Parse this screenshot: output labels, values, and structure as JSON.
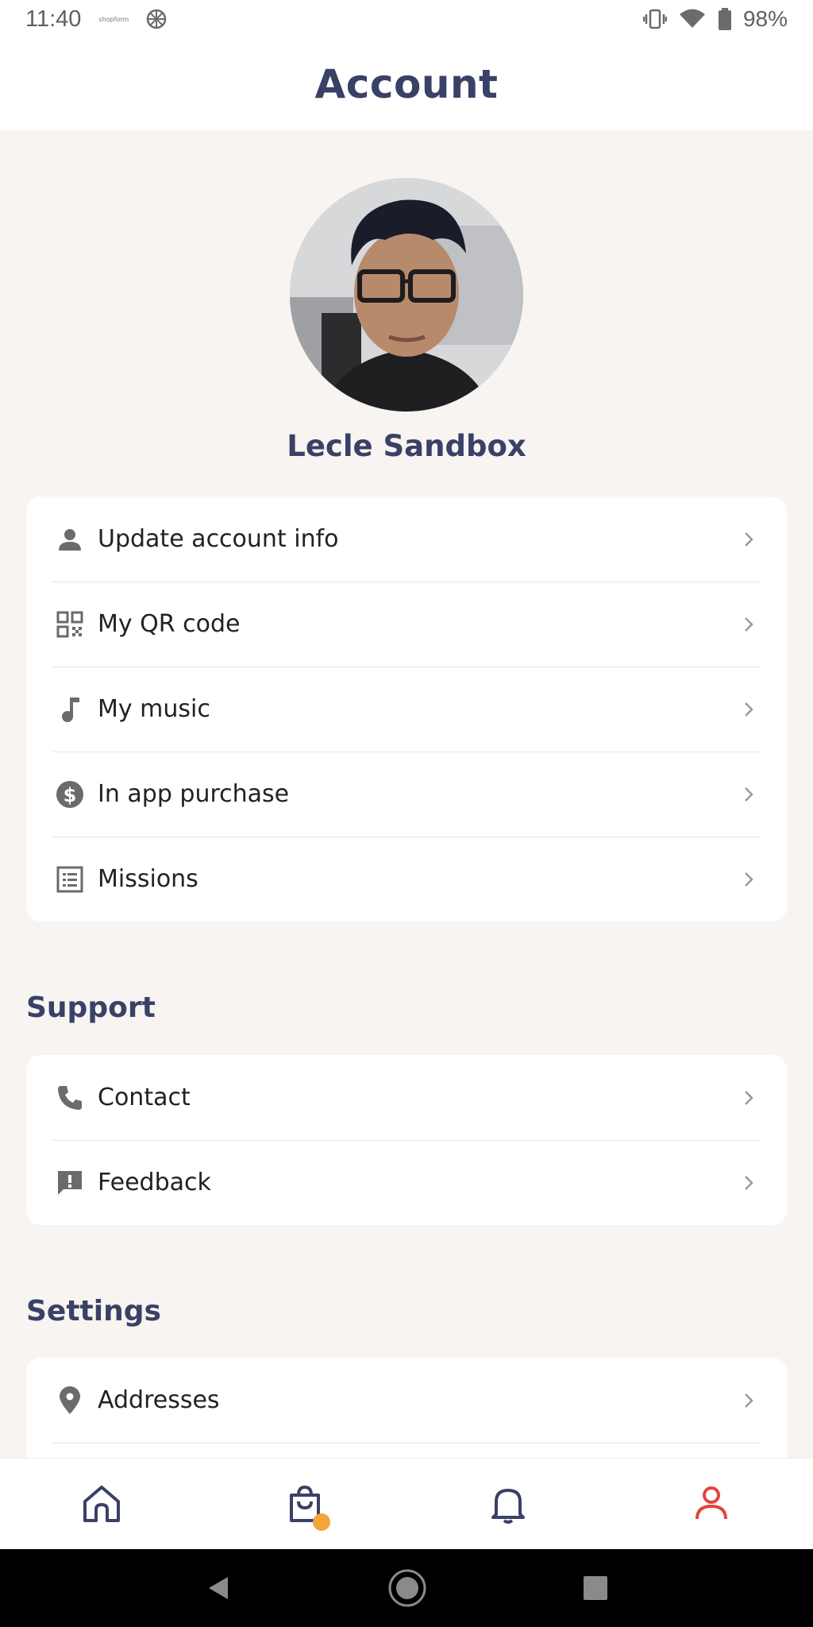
{
  "status_bar": {
    "time": "11:40",
    "app_tag": "shopform",
    "battery": "98%"
  },
  "header": {
    "title": "Account"
  },
  "profile": {
    "name": "Lecle Sandbox"
  },
  "account_menu": [
    {
      "label": "Update account info",
      "icon": "person-icon"
    },
    {
      "label": "My QR code",
      "icon": "qr-code-icon"
    },
    {
      "label": "My music",
      "icon": "music-note-icon"
    },
    {
      "label": "In app purchase",
      "icon": "dollar-circle-icon"
    },
    {
      "label": "Missions",
      "icon": "list-icon"
    }
  ],
  "support": {
    "title": "Support",
    "items": [
      {
        "label": "Contact",
        "icon": "phone-icon"
      },
      {
        "label": "Feedback",
        "icon": "feedback-icon"
      }
    ]
  },
  "settings": {
    "title": "Settings",
    "items": [
      {
        "label": "Addresses",
        "icon": "location-pin-icon"
      }
    ]
  },
  "bottom_nav": [
    {
      "name": "home-icon",
      "active": false
    },
    {
      "name": "shopping-bag-icon",
      "active": false,
      "badge": true
    },
    {
      "name": "bell-icon",
      "active": false
    },
    {
      "name": "profile-icon",
      "active": true
    }
  ],
  "colors": {
    "primary": "#3a4166",
    "active": "#e0463d",
    "badge": "#f3a53a",
    "background": "#f7f4f1",
    "icon_gray": "#6b6b6b"
  }
}
